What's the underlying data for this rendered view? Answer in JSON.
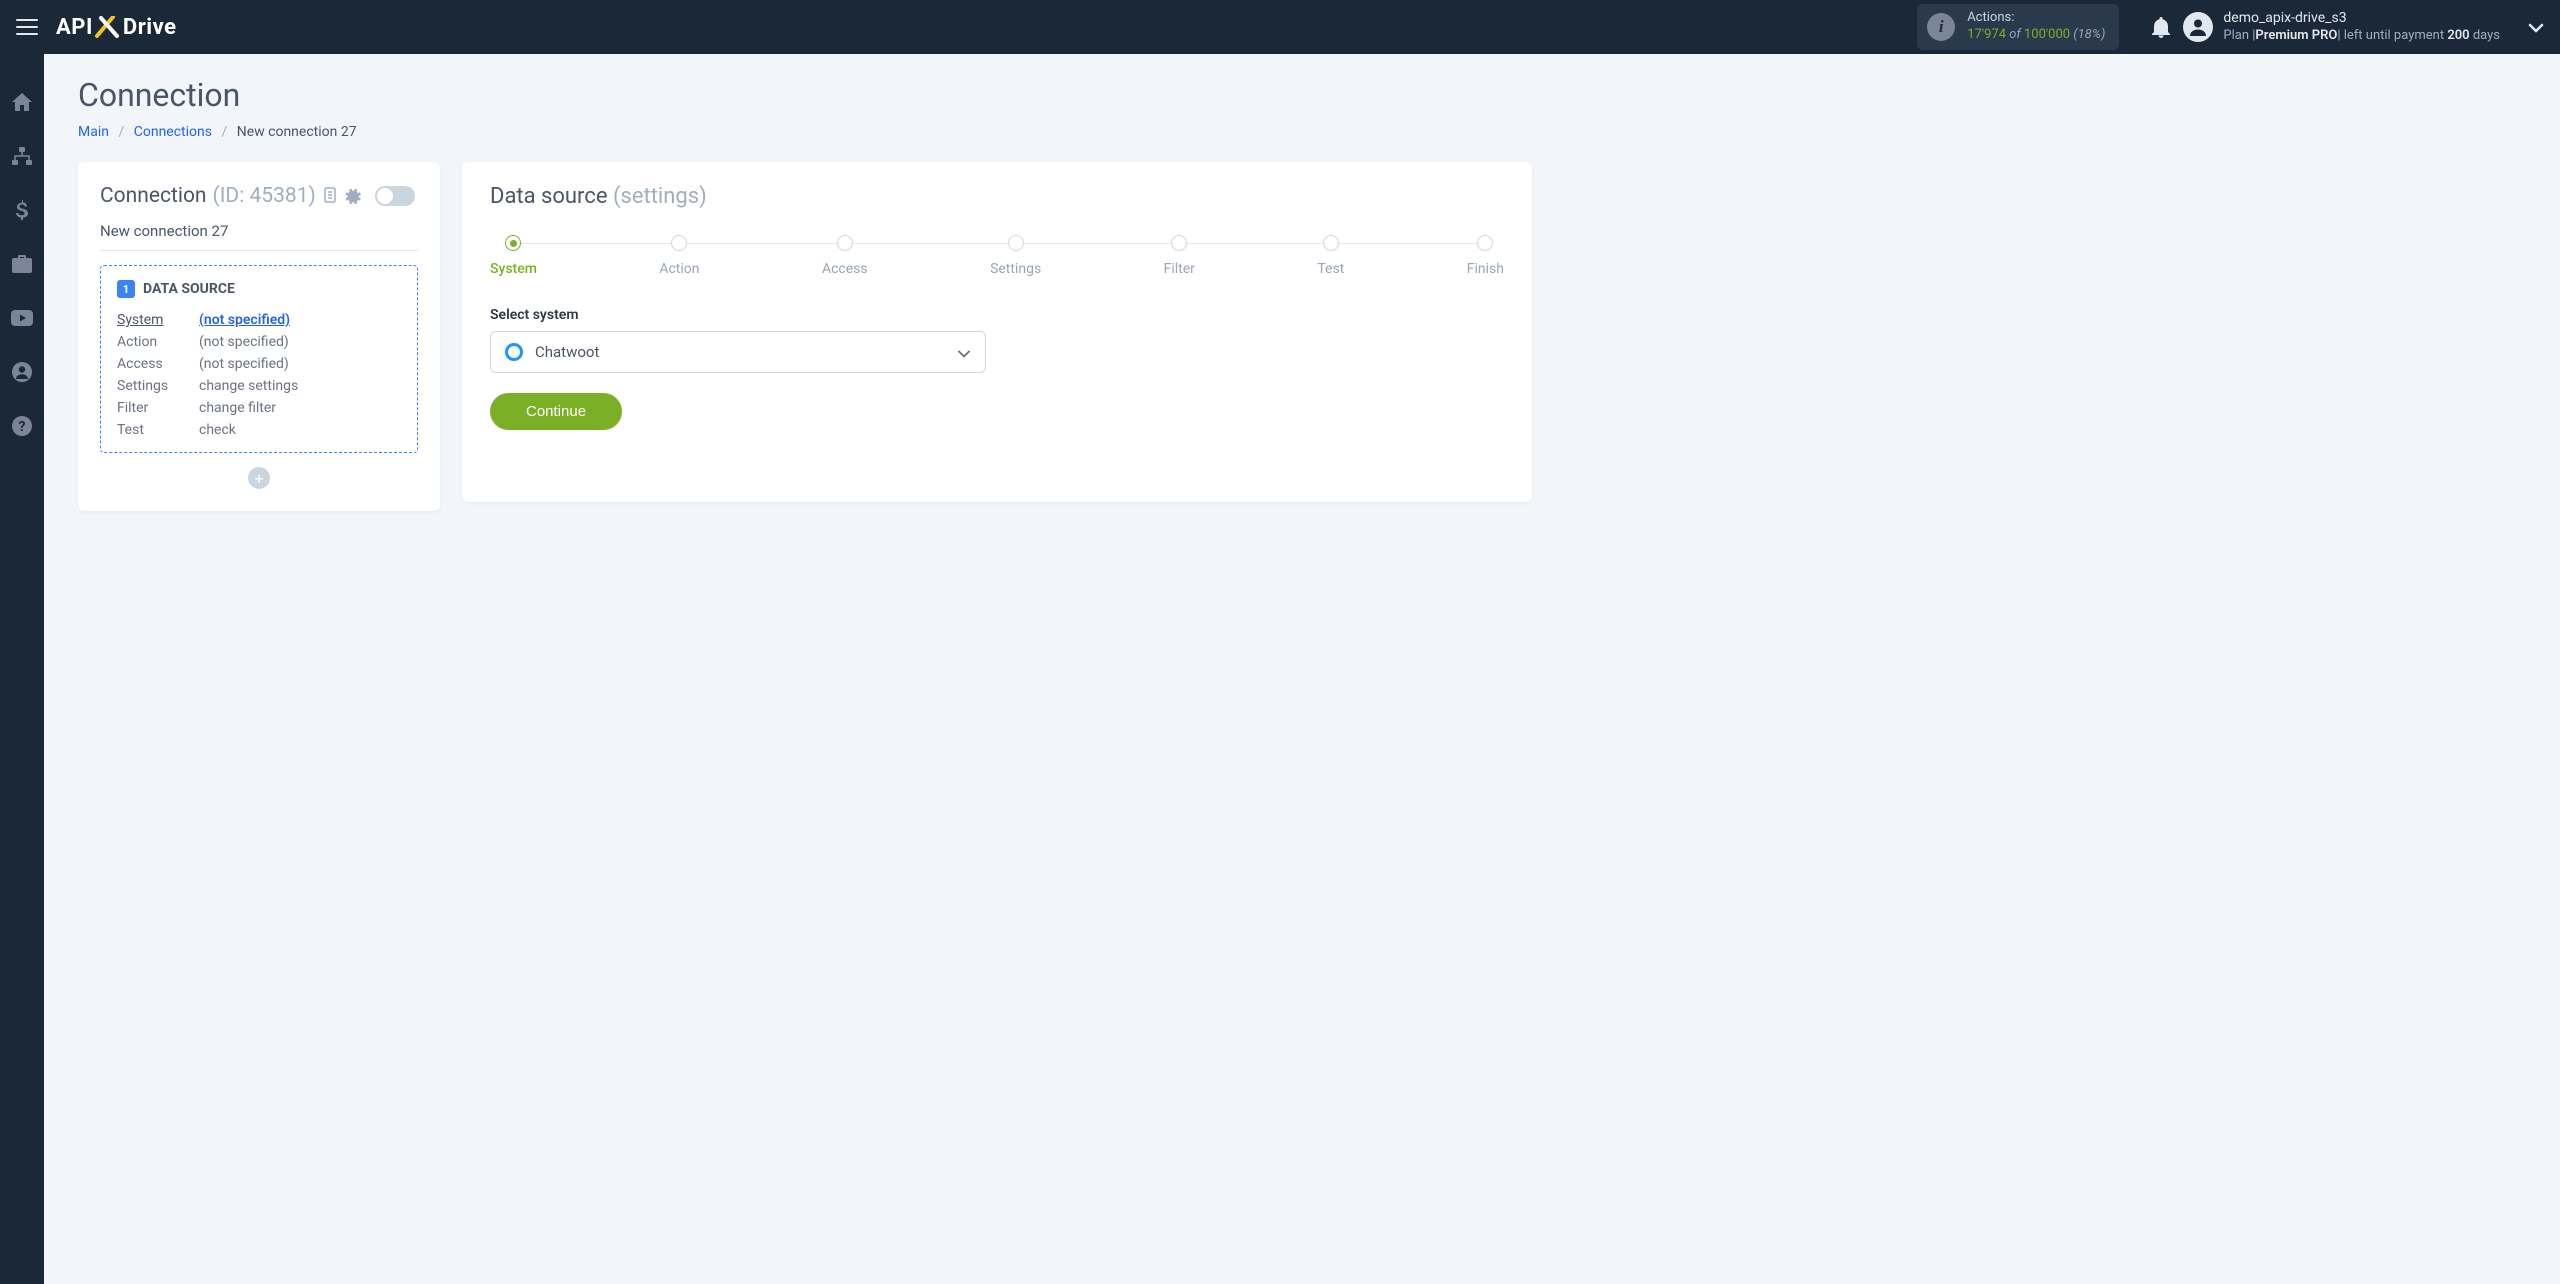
{
  "header": {
    "logo_left": "API",
    "logo_right": "Drive",
    "actions_label": "Actions:",
    "actions_used": "17'974",
    "actions_of": " of ",
    "actions_total": "100'000",
    "actions_pct": " (18%)",
    "user_name": "demo_apix-drive_s3",
    "plan_prefix": "Plan |",
    "plan_name": "Premium PRO",
    "plan_mid": "| left until payment ",
    "plan_days": "200",
    "plan_suffix": " days"
  },
  "page": {
    "title": "Connection",
    "breadcrumb": {
      "main": "Main",
      "connections": "Connections",
      "current": "New connection 27"
    }
  },
  "left": {
    "heading": "Connection ",
    "id": "(ID: 45381)",
    "name": "New connection 27",
    "ds_badge": "1",
    "ds_title": "DATA SOURCE",
    "rows": {
      "system_k": "System",
      "system_v": "(not specified)",
      "action_k": "Action",
      "action_v": "(not specified)",
      "access_k": "Access",
      "access_v": "(not specified)",
      "settings_k": "Settings",
      "settings_v": "change settings",
      "filter_k": "Filter",
      "filter_v": "change filter",
      "test_k": "Test",
      "test_v": "check"
    },
    "add": "+"
  },
  "right": {
    "heading": "Data source ",
    "heading_sub": "(settings)",
    "steps": [
      "System",
      "Action",
      "Access",
      "Settings",
      "Filter",
      "Test",
      "Finish"
    ],
    "select_label": "Select system",
    "select_value": "Chatwoot",
    "continue": "Continue"
  }
}
